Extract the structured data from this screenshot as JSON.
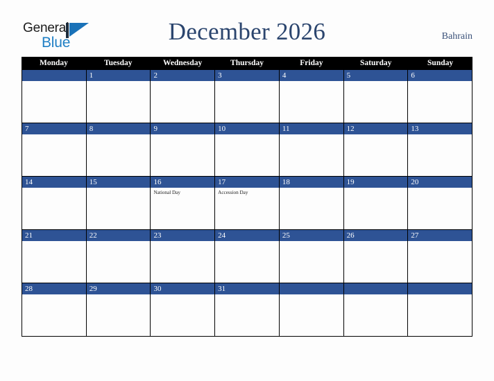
{
  "brand": {
    "name_line1": "General",
    "name_line2": "Blue",
    "mark_icon": "triangle-flag-icon",
    "color_dark": "#1c1c1c",
    "color_blue": "#1f7fc4"
  },
  "header": {
    "title": "December 2026",
    "location": "Bahrain",
    "title_color": "#2b456e",
    "location_color": "#3a5179"
  },
  "calendar": {
    "accent_color": "#2e5395",
    "header_bg": "#000000",
    "weekdays": [
      "Monday",
      "Tuesday",
      "Wednesday",
      "Thursday",
      "Friday",
      "Saturday",
      "Sunday"
    ],
    "weeks": [
      [
        {
          "num": "",
          "event": ""
        },
        {
          "num": "1",
          "event": ""
        },
        {
          "num": "2",
          "event": ""
        },
        {
          "num": "3",
          "event": ""
        },
        {
          "num": "4",
          "event": ""
        },
        {
          "num": "5",
          "event": ""
        },
        {
          "num": "6",
          "event": ""
        }
      ],
      [
        {
          "num": "7",
          "event": ""
        },
        {
          "num": "8",
          "event": ""
        },
        {
          "num": "9",
          "event": ""
        },
        {
          "num": "10",
          "event": ""
        },
        {
          "num": "11",
          "event": ""
        },
        {
          "num": "12",
          "event": ""
        },
        {
          "num": "13",
          "event": ""
        }
      ],
      [
        {
          "num": "14",
          "event": ""
        },
        {
          "num": "15",
          "event": ""
        },
        {
          "num": "16",
          "event": "National Day"
        },
        {
          "num": "17",
          "event": "Accession Day"
        },
        {
          "num": "18",
          "event": ""
        },
        {
          "num": "19",
          "event": ""
        },
        {
          "num": "20",
          "event": ""
        }
      ],
      [
        {
          "num": "21",
          "event": ""
        },
        {
          "num": "22",
          "event": ""
        },
        {
          "num": "23",
          "event": ""
        },
        {
          "num": "24",
          "event": ""
        },
        {
          "num": "25",
          "event": ""
        },
        {
          "num": "26",
          "event": ""
        },
        {
          "num": "27",
          "event": ""
        }
      ],
      [
        {
          "num": "28",
          "event": ""
        },
        {
          "num": "29",
          "event": ""
        },
        {
          "num": "30",
          "event": ""
        },
        {
          "num": "31",
          "event": ""
        },
        {
          "num": "",
          "event": ""
        },
        {
          "num": "",
          "event": ""
        },
        {
          "num": "",
          "event": ""
        }
      ]
    ]
  }
}
